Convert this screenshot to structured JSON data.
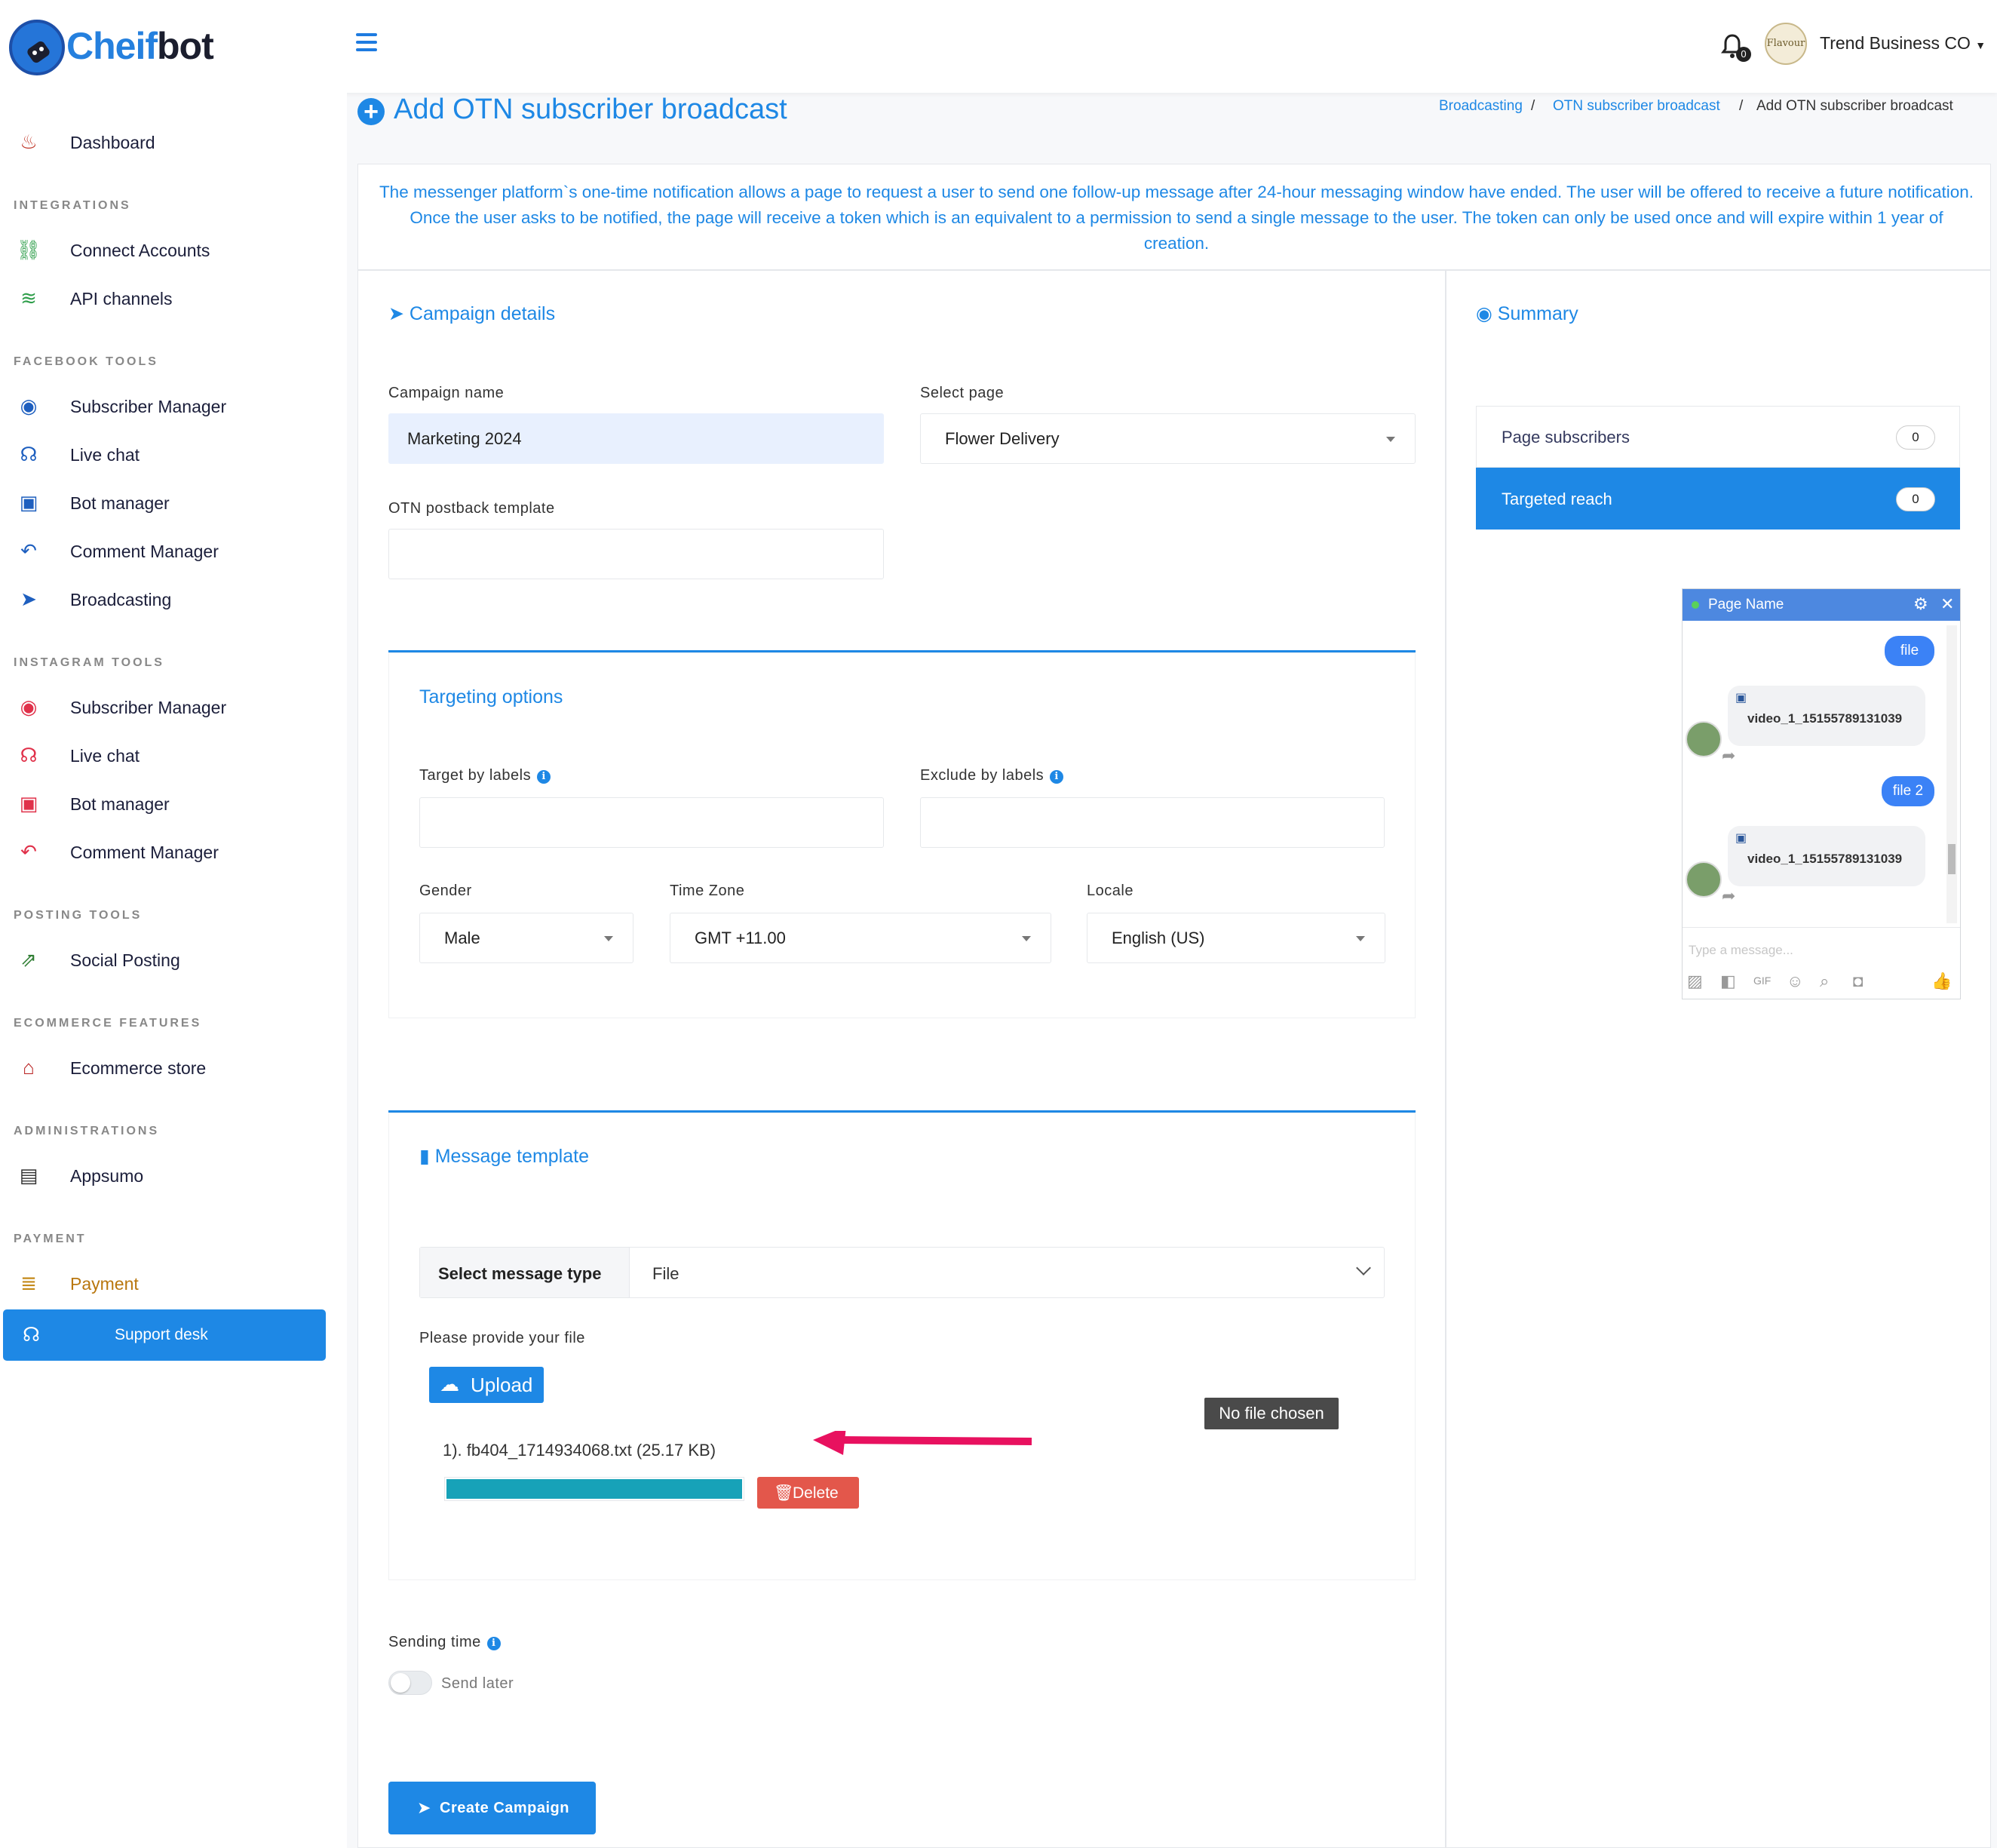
{
  "brand": {
    "name_part1": "Cheif",
    "name_part2": "bot"
  },
  "header": {
    "notifications_count": "0",
    "avatar_text": "Flavour",
    "company": "Trend Business CO"
  },
  "sidebar": {
    "items": [
      {
        "section": "",
        "label": "Dashboard",
        "icon": "flame-icon",
        "color": "#c0392b"
      },
      {
        "section": "INTEGRATIONS",
        "label": "Connect Accounts",
        "icon": "link-icon",
        "color": "#2e9e4a"
      },
      {
        "section": "",
        "label": "API channels",
        "icon": "wifi-icon",
        "color": "#2e9e4a"
      },
      {
        "section": "FACEBOOK TOOLS",
        "label": "Subscriber Manager",
        "icon": "user-circle-icon",
        "color": "#1e5fbf"
      },
      {
        "section": "",
        "label": "Live chat",
        "icon": "headset-icon",
        "color": "#1e5fbf"
      },
      {
        "section": "",
        "label": "Bot manager",
        "icon": "robot-icon",
        "color": "#1e5fbf"
      },
      {
        "section": "",
        "label": "Comment Manager",
        "icon": "reply-all-icon",
        "color": "#1e5fbf"
      },
      {
        "section": "",
        "label": "Broadcasting",
        "icon": "paper-plane-icon",
        "color": "#1e5fbf"
      },
      {
        "section": "INSTAGRAM TOOLS",
        "label": "Subscriber Manager",
        "icon": "user-circle-icon",
        "color": "#e0314a"
      },
      {
        "section": "",
        "label": "Live chat",
        "icon": "headset-icon",
        "color": "#e0314a"
      },
      {
        "section": "",
        "label": "Bot manager",
        "icon": "robot-icon",
        "color": "#e0314a"
      },
      {
        "section": "",
        "label": "Comment Manager",
        "icon": "reply-all-icon",
        "color": "#e0314a"
      },
      {
        "section": "POSTING TOOLS",
        "label": "Social Posting",
        "icon": "share-square-icon",
        "color": "#2e7d32"
      },
      {
        "section": "ECOMMERCE FEATURES",
        "label": "Ecommerce store",
        "icon": "store-icon",
        "color": "#b71c1c"
      },
      {
        "section": "ADMINISTRATIONS",
        "label": "Appsumo",
        "icon": "id-card-icon",
        "color": "#333333"
      },
      {
        "section": "PAYMENT",
        "label": "Payment",
        "icon": "coins-icon",
        "color": "#c48a1a"
      }
    ],
    "support_label": "Support desk"
  },
  "page": {
    "title": "Add OTN subscriber broadcast",
    "breadcrumb": [
      "Broadcasting",
      "OTN subscriber broadcast",
      "Add OTN subscriber broadcast"
    ],
    "notice": "The messenger platform`s one-time notification allows a page to request a user to send one follow-up message after 24-hour messaging window have ended. The user will be offered to receive a future notification. Once the user asks to be notified, the page will receive a token which is an equivalent to a permission to send a single message to the user. The token can only be used once and will expire within 1 year of creation."
  },
  "campaign": {
    "section_title": "Campaign details",
    "name_label": "Campaign name",
    "name_value": "Marketing 2024",
    "page_label": "Select page",
    "page_value": "Flower Delivery",
    "postback_label": "OTN postback template",
    "postback_value": ""
  },
  "targeting": {
    "title": "Targeting options",
    "target_labels": "Target by labels",
    "exclude_labels": "Exclude by labels",
    "gender_label": "Gender",
    "gender_value": "Male",
    "timezone_label": "Time Zone",
    "timezone_value": "GMT +11.00",
    "locale_label": "Locale",
    "locale_value": "English (US)"
  },
  "message": {
    "title": "Message template",
    "type_label": "Select message type",
    "type_value": "File",
    "file_prompt": "Please provide your file",
    "upload_label": "Upload",
    "no_file": "No file chosen",
    "file_entry": "1). fb404_1714934068.txt (25.17 KB)",
    "progress": 1.0,
    "delete_label": "Delete"
  },
  "sending": {
    "label": "Sending time",
    "toggle_label": "Send later",
    "toggle_on": false
  },
  "create_label": "Create Campaign",
  "summary": {
    "title": "Summary",
    "page_subscribers_label": "Page subscribers",
    "page_subscribers_value": "0",
    "targeted_reach_label": "Targeted reach",
    "targeted_reach_value": "0"
  },
  "preview": {
    "page_name": "Page Name",
    "bubble1": "file",
    "attachment1": "video_1_15155789131039",
    "bubble2": "file 2",
    "attachment2": "video_1_15155789131039",
    "placeholder": "Type a message..."
  },
  "colors": {
    "accent": "#1e88e5",
    "danger": "#e3574b",
    "progress": "#17a2b8"
  }
}
